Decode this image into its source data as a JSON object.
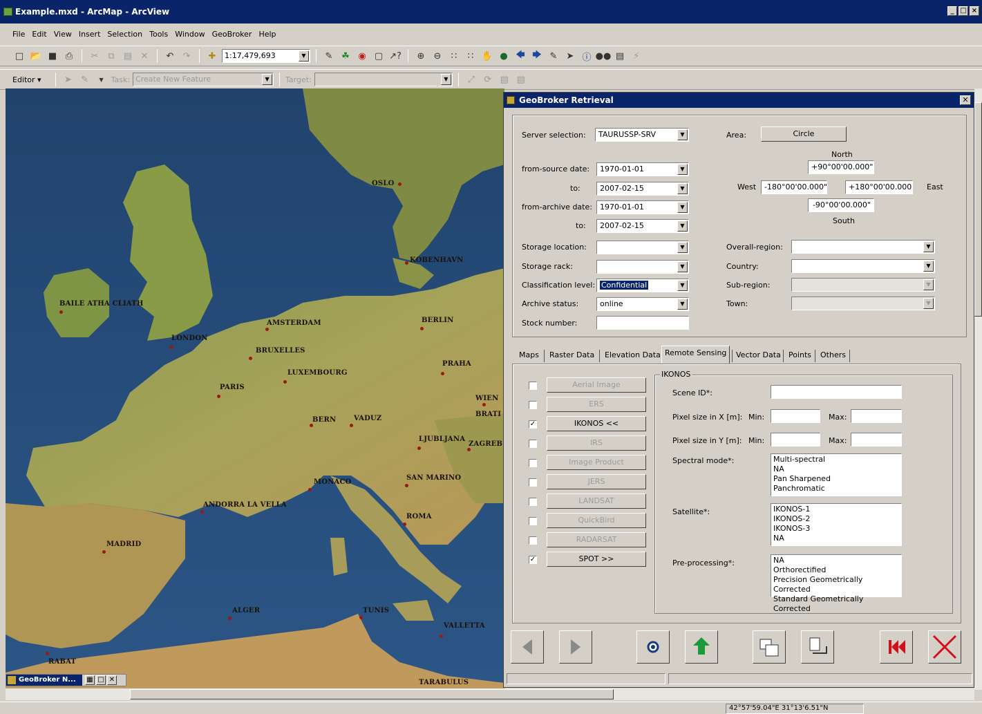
{
  "window": {
    "title": "Example.mxd - ArcMap - ArcView",
    "buttons": [
      "_",
      "□",
      "×"
    ]
  },
  "menu": [
    "File",
    "Edit",
    "View",
    "Insert",
    "Selection",
    "Tools",
    "Window",
    "GeoBroker",
    "Help"
  ],
  "toolbar": {
    "scale": "1:17,479,693"
  },
  "editor": {
    "label": "Editor ▾",
    "task_label": "Task:",
    "task_value": "Create New Feature",
    "target_label": "Target:",
    "target_value": ""
  },
  "map": {
    "cities": [
      "OSLO",
      "KOBENHAVN",
      "BAILE ATHA CLIATH",
      "AMSTERDAM",
      "BERLIN",
      "LONDON",
      "BRUXELLES",
      "PRAHA",
      "LUXEMBOURG",
      "PARIS",
      "WIEN",
      "BRATI",
      "BERN",
      "VADUZ",
      "LJUBLJANA",
      "ZAGREB",
      "MONACO",
      "SAN MARINO",
      "ANDORRA LA VELLA",
      "ROMA",
      "MADRID",
      "ALGER",
      "TUNIS",
      "VALLETTA",
      "RABAT",
      "TARABULUS"
    ]
  },
  "dialog": {
    "title": "GeoBroker Retrieval",
    "server_label": "Server selection:",
    "server_value": "TAURUSSP-SRV",
    "from_source_label": "from-source date:",
    "from_source_value": "1970-01-01",
    "to_label": "to:",
    "to_source_value": "2007-02-15",
    "from_archive_label": "from-archive date:",
    "from_archive_value": "1970-01-01",
    "to_label2": "to:",
    "to_archive_value": "2007-02-15",
    "storage_location_label": "Storage location:",
    "storage_location_value": "",
    "storage_rack_label": "Storage rack:",
    "storage_rack_value": "",
    "classification_label": "Classification level:",
    "classification_value": "Confidential",
    "archive_status_label": "Archive status:",
    "archive_status_value": "online",
    "stock_number_label": "Stock number:",
    "stock_number_value": "",
    "area_label": "Area:",
    "area_button": "Circle",
    "north_label": "North",
    "north_value": "+90°00'00.000\"",
    "west_label": "West",
    "west_value": "-180°00'00.000\"",
    "east_value": "+180°00'00.000\"",
    "east_label": "East",
    "south_value": "-90°00'00.000\"",
    "south_label": "South",
    "overall_region_label": "Overall-region:",
    "country_label": "Country:",
    "subregion_label": "Sub-region:",
    "town_label": "Town:",
    "tabs": [
      "Maps",
      "Raster Data",
      "Elevation Data",
      "Remote Sensing",
      "Vector Data",
      "Points",
      "Others"
    ],
    "sensors": [
      {
        "label": "Aerial Image",
        "checked": false,
        "enabled": false
      },
      {
        "label": "ERS",
        "checked": false,
        "enabled": false
      },
      {
        "label": "IKONOS <<",
        "checked": true,
        "enabled": true
      },
      {
        "label": "IRS",
        "checked": false,
        "enabled": false
      },
      {
        "label": "Image Product",
        "checked": false,
        "enabled": false
      },
      {
        "label": "JERS",
        "checked": false,
        "enabled": false
      },
      {
        "label": "LANDSAT",
        "checked": false,
        "enabled": false
      },
      {
        "label": "QuickBird",
        "checked": false,
        "enabled": false
      },
      {
        "label": "RADARSAT",
        "checked": false,
        "enabled": false
      },
      {
        "label": "SPOT >>",
        "checked": true,
        "enabled": true
      }
    ],
    "ikonos": {
      "group_title": "IKONOS",
      "scene_id_label": "Scene ID*:",
      "pixel_x_label": "Pixel size in X [m]:",
      "pixel_y_label": "Pixel size in Y [m]:",
      "min_label": "Min:",
      "max_label": "Max:",
      "spectral_label": "Spectral mode*:",
      "spectral_options": [
        "Multi-spectral",
        "NA",
        "Pan Sharpened",
        "Panchromatic"
      ],
      "satellite_label": "Satellite*:",
      "satellite_options": [
        "IKONOS-1",
        "IKONOS-2",
        "IKONOS-3",
        "NA"
      ],
      "preprocessing_label": "Pre-processing*:",
      "preprocessing_options": [
        "NA",
        "Orthorectified",
        "Precision Geometrically Corrected",
        "Standard Geometrically Corrected"
      ]
    }
  },
  "mini_window": {
    "title": "GeoBroker N..."
  },
  "status": {
    "coords": "42°57'59.04\"E  31°13'6.51\"N"
  },
  "colors": {
    "titlebar": "#0a246a",
    "face": "#d4d0c8",
    "accent_green": "#1a8a2a",
    "accent_red": "#d0101a"
  }
}
